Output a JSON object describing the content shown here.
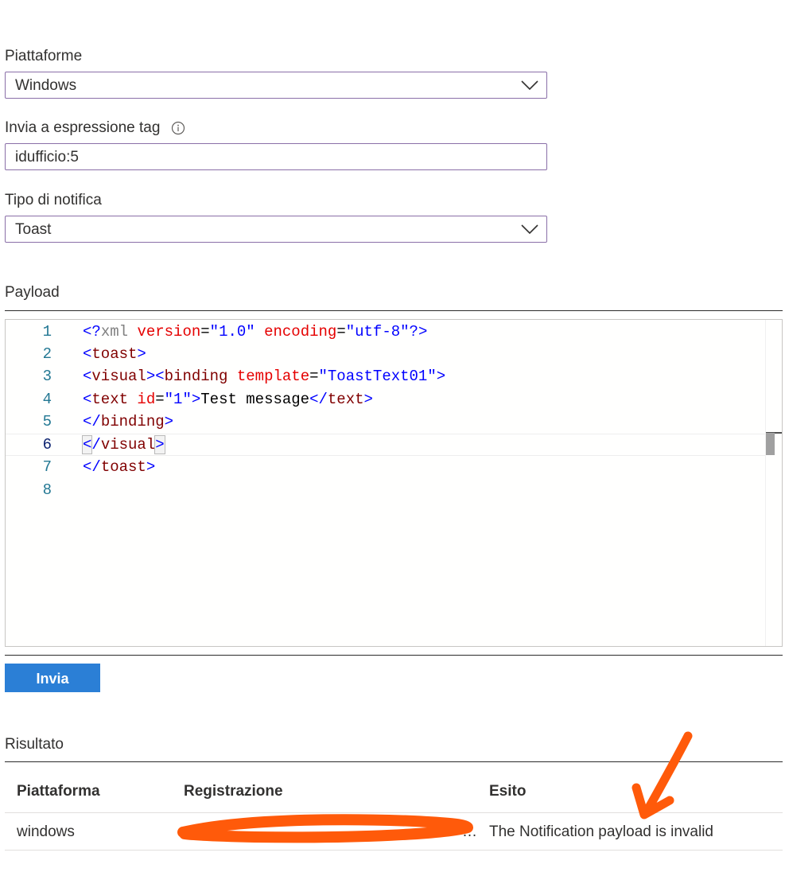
{
  "form": {
    "platform_label": "Piattaforme",
    "platform_value": "Windows",
    "tag_label": "Invia a espressione tag",
    "tag_value": "idufficio:5",
    "type_label": "Tipo di notifica",
    "type_value": "Toast"
  },
  "payload": {
    "label": "Payload",
    "line_numbers": [
      "1",
      "2",
      "3",
      "4",
      "5",
      "6",
      "7",
      "8"
    ],
    "current_line": 6,
    "line1": {
      "a": "<?",
      "b": "xml",
      "c": " ",
      "d": "version",
      "e": "=",
      "f": "\"1.0\"",
      "g": " ",
      "h": "encoding",
      "i": "=",
      "j": "\"utf-8\"",
      "k": "?>"
    },
    "line2": {
      "a": "<",
      "b": "toast",
      "c": ">"
    },
    "line3": {
      "a": "<",
      "b": "visual",
      "c": "><",
      "d": "binding",
      "e": " ",
      "f": "template",
      "g": "=",
      "h": "\"ToastText01\"",
      "i": ">"
    },
    "line4": {
      "a": "<",
      "b": "text",
      "c": " ",
      "d": "id",
      "e": "=",
      "f": "\"1\"",
      "g": ">",
      "h": "Test message",
      "i": "</",
      "j": "text",
      "k": ">"
    },
    "line5": {
      "a": "</",
      "b": "binding",
      "c": ">"
    },
    "line6": {
      "a": "<",
      "b": "/",
      "c": "visual",
      "d": ">"
    },
    "line7": {
      "a": "</",
      "b": "toast",
      "c": ">"
    }
  },
  "send_button": "Invia",
  "result": {
    "label": "Risultato",
    "columns": [
      "Piattaforma",
      "Registrazione",
      "Esito"
    ],
    "row": {
      "platform": "windows",
      "registration": "…",
      "outcome": "The Notification payload is invalid"
    }
  },
  "colors": {
    "button": "#2b7fd6",
    "field_border": "#8a6fa8",
    "annotation": "#ff5a0a"
  },
  "icons": [
    "chevron-down-icon",
    "info-icon",
    "arrow-annotation-icon"
  ]
}
